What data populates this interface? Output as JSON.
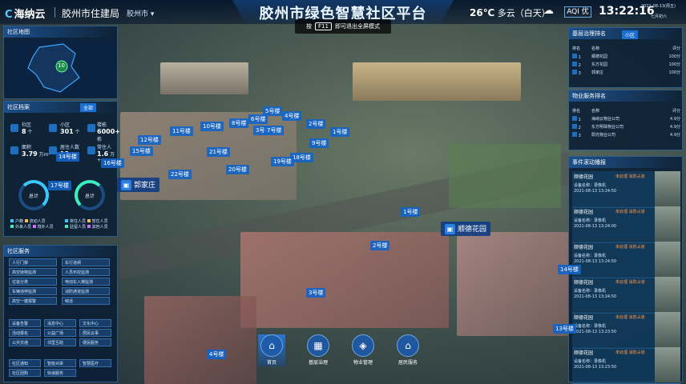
{
  "header": {
    "logo": "海纳云",
    "org": "胶州市住建局",
    "city_select": "胶州市 ▾",
    "title": "胶州市绿色智慧社区平台",
    "temperature": "26℃",
    "weather": "多云（白天）",
    "aqi": "优",
    "time": "13:22:16",
    "date": "2021-08-13(周五)",
    "weekday": "七月初六"
  },
  "fullscreen_tip": {
    "prefix": "按",
    "key": "F11",
    "suffix": "即可退出全屏模式"
  },
  "left": {
    "map": {
      "title": "社区地图",
      "count": "10"
    },
    "archive": {
      "title": "社区档案",
      "tab_all": "全部",
      "tab_other": "",
      "stats": [
        {
          "label": "社区",
          "value": "8",
          "unit": "个"
        },
        {
          "label": "小区",
          "value": "301",
          "unit": "个"
        },
        {
          "label": "楼栋",
          "value": "6000+",
          "unit": "栋"
        },
        {
          "label": "面积",
          "value": "3.79",
          "unit": "万m²"
        },
        {
          "label": "居住人数",
          "value": "12",
          "unit": "万+"
        },
        {
          "label": "常住人",
          "value": "1.6",
          "unit": "万+"
        }
      ],
      "ring1_label": "总计",
      "ring2_label": "总计",
      "legend1": [
        "户籍",
        "流动人员",
        "外来人员",
        "境外人员"
      ],
      "legend2": [
        "常住人员",
        "暂住人员",
        "驻留人员",
        "其他人员"
      ]
    },
    "services": {
      "title": "社区服务",
      "buttons": [
        "人行门禁",
        "车行道闸",
        "高空抛物监测",
        "人员布控监测",
        "垃圾分类",
        "电动车入梯监测",
        "车辆违停监测",
        "消防通道监测",
        "高空一键报警",
        "喊话",
        "设备告警",
        "消息中心",
        "文化中心",
        "活动报名",
        "公益广场",
        "居民议事",
        "公共交通",
        "邻里互助",
        "便民服务",
        "社区通知",
        "智能对讲",
        "智慧医疗",
        "社区团购",
        "快递服务"
      ]
    }
  },
  "right": {
    "gov": {
      "title": "基层治理排名",
      "tab": "小区",
      "col_rank": "排名",
      "col_name": "名称",
      "col_score": "评分",
      "rows": [
        {
          "rank": "1",
          "name": "顺德花园",
          "score": "100分"
        },
        {
          "rank": "2",
          "name": "东方花园",
          "score": "100分"
        },
        {
          "rank": "3",
          "name": "郭家庄",
          "score": "100分"
        }
      ]
    },
    "property": {
      "title": "物业服务排名",
      "col_rank": "排名",
      "col_name": "名称",
      "col_score": "评分",
      "rows": [
        {
          "rank": "1",
          "name": "海纳云物业公司",
          "score": "4.9分"
        },
        {
          "rank": "2",
          "name": "东方明珠物业公司",
          "score": "4.9分"
        },
        {
          "rank": "3",
          "name": "阳光物业公司",
          "score": "4.9分"
        }
      ]
    },
    "events": {
      "title": "事件滚动播报",
      "cards": [
        {
          "place": "顺德花园",
          "status": "未处理  消防占道",
          "device": "设备名称：录像机",
          "time": "2021-08-13 13:24:50"
        },
        {
          "place": "顺德花园",
          "status": "未处理  消防占道",
          "device": "设备名称：录像机",
          "time": "2021-08-13 13:24:00"
        },
        {
          "place": "顺德花园",
          "status": "未处理  消防占道",
          "device": "设备名称：录像机",
          "time": "2021-08-13 13:24:50"
        },
        {
          "place": "顺德花园",
          "status": "未处理  消防占道",
          "device": "设备名称：录像机",
          "time": "2021-08-13 13:24:50"
        },
        {
          "place": "顺德花园",
          "status": "未处理  消防占道",
          "device": "设备名称：录像机",
          "time": "2021-08-13 13:23:50"
        },
        {
          "place": "顺德花园",
          "status": "未处理  消防占道",
          "device": "设备名称：录像机",
          "time": "2021-08-13 13:23:50"
        }
      ]
    }
  },
  "map_tags": {
    "buildings": [
      {
        "id": "b5",
        "label": "5号楼"
      },
      {
        "id": "b4",
        "label": "4号楼"
      },
      {
        "id": "b6",
        "label": "6号楼"
      },
      {
        "id": "b8",
        "label": "8号楼"
      },
      {
        "id": "b3t",
        "label": "3号楼"
      },
      {
        "id": "b2t",
        "label": "2号楼"
      },
      {
        "id": "b11",
        "label": "11号楼"
      },
      {
        "id": "b10",
        "label": "10号楼"
      },
      {
        "id": "b7",
        "label": "7号楼"
      },
      {
        "id": "b1t",
        "label": "1号楼"
      },
      {
        "id": "b12",
        "label": "12号楼"
      },
      {
        "id": "b9",
        "label": "9号楼"
      },
      {
        "id": "b21",
        "label": "21号楼"
      },
      {
        "id": "b15",
        "label": "15号楼"
      },
      {
        "id": "b18",
        "label": "18号楼"
      },
      {
        "id": "b19",
        "label": "19号楼"
      },
      {
        "id": "b20",
        "label": "20号楼"
      },
      {
        "id": "b22",
        "label": "22号楼"
      },
      {
        "id": "b1",
        "label": "1号楼"
      },
      {
        "id": "b2",
        "label": "2号楼"
      },
      {
        "id": "b3",
        "label": "3号楼"
      },
      {
        "id": "b4b",
        "label": "4号楼"
      },
      {
        "id": "b13",
        "label": "13号楼"
      },
      {
        "id": "b14",
        "label": "14号楼"
      },
      {
        "id": "b16",
        "label": "16号楼"
      },
      {
        "id": "b14l",
        "label": "14号楼"
      },
      {
        "id": "b17",
        "label": "17号楼"
      }
    ],
    "areas": [
      {
        "id": "guojia",
        "label": "郭家庄"
      },
      {
        "id": "shunde",
        "label": "顺德花园"
      }
    ]
  },
  "bottom_nav": [
    {
      "label": "首页",
      "icon": "home-icon"
    },
    {
      "label": "基层治理",
      "icon": "governance-icon"
    },
    {
      "label": "物业管理",
      "icon": "property-icon"
    },
    {
      "label": "居民服务",
      "icon": "resident-icon"
    }
  ]
}
